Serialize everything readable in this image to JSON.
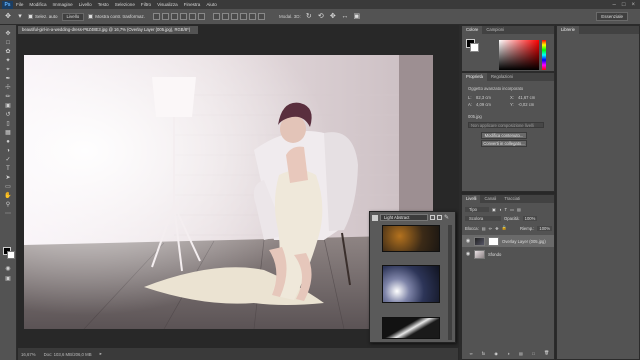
{
  "menu": {
    "logo": "Ps",
    "items": [
      "File",
      "Modifica",
      "Immagine",
      "Livello",
      "Testo",
      "Selezione",
      "Filtro",
      "Visualizza",
      "Finestra",
      "Aiuto"
    ]
  },
  "options": {
    "autoselect_label": "Selez. auto",
    "autoselect_value": "Livello",
    "transform_label": "Mostra contr. trasformaz.",
    "mode3d_label": "Modal. 3D:",
    "workspace": "Essenziale"
  },
  "document": {
    "tab_title": "beautiful-girl-in-a-wedding-dress-P6Z48E3.jpg @ 16,7% (Overlay Layer (005.jpg), RGB/8*)",
    "zoom": "16,67%",
    "doc_size": "Doc: 103,6 MB/206,0 MB"
  },
  "color_panel": {
    "tabs": [
      "Colore",
      "Campioni"
    ]
  },
  "libraries_panel": {
    "tab": "Librerie"
  },
  "properties_panel": {
    "tabs": [
      "Proprietà",
      "Regolazioni"
    ],
    "object_name": "Oggetto avanzato incorporato",
    "w_label": "L:",
    "w_value": "82,3 cm",
    "x_label": "X:",
    "x_value": "41,67 cm",
    "h_label": "A:",
    "h_value": "4,09 cm",
    "y_label": "Y:",
    "y_value": "-0,02 cm",
    "file_name": "005.jpg",
    "comps_placeholder": "Non applicare composizione livelli",
    "edit_button": "Modifica contenuto...",
    "convert_button": "Converti in collegato..."
  },
  "layers_panel": {
    "tabs": [
      "Livelli",
      "Canali",
      "Tracciati"
    ],
    "filter_label": "Tipo",
    "blend_mode": "Scolora",
    "opacity_label": "Opacità:",
    "opacity_value": "100%",
    "lock_label": "Blocca:",
    "fill_label": "Riemp.:",
    "fill_value": "100%",
    "layers": [
      {
        "name": "Overlay Layer (005.jpg)"
      },
      {
        "name": "Sfondo"
      }
    ]
  },
  "library_picker": {
    "selected": "Light Abstract"
  },
  "colors": {
    "accent": "#31a8ff",
    "panel_bg": "#535353",
    "app_bg": "#282828"
  }
}
